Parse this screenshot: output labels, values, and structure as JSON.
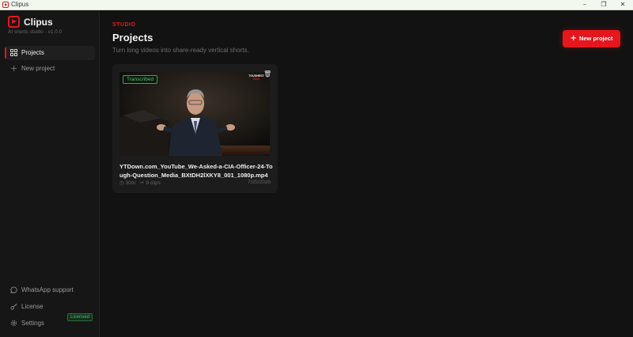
{
  "window": {
    "title": "Clipus",
    "controls": {
      "minimize": "–",
      "restore": "❐",
      "close": "✕"
    }
  },
  "sidebar": {
    "brand": "Clipus",
    "tagline": "AI shorts studio · v1.0.0",
    "nav": [
      {
        "label": "Projects",
        "icon": "grid-icon",
        "active": true
      },
      {
        "label": "New project",
        "icon": "plus-icon",
        "active": false
      }
    ],
    "footer": [
      {
        "label": "WhatsApp support",
        "icon": "chat-icon"
      },
      {
        "label": "License",
        "icon": "key-icon",
        "badge": "Licensed"
      },
      {
        "label": "Settings",
        "icon": "gear-icon"
      }
    ]
  },
  "main": {
    "eyebrow": "STUDIO",
    "title": "Projects",
    "subtitle": "Turn long videos into share-ready vertical shorts.",
    "new_button": "New project",
    "projects": [
      {
        "status": "Transcribed",
        "file_name": "YTDown.com_YouTube_We-Asked-a-CIA-Officer-24-Tough-Question_Media_BXtDH2lXKY8_001_1080p.mp4",
        "duration": "30m",
        "clips": "9 clips",
        "date": "7/25/2026",
        "thumb_logo_line1": "TOUGHEST",
        "thumb_logo_line2": "BOX"
      }
    ]
  },
  "colors": {
    "accent": "#e5161c",
    "success": "#52c56e",
    "background": "#121212",
    "sidebar": "#161616",
    "card": "#1c1c1c"
  }
}
